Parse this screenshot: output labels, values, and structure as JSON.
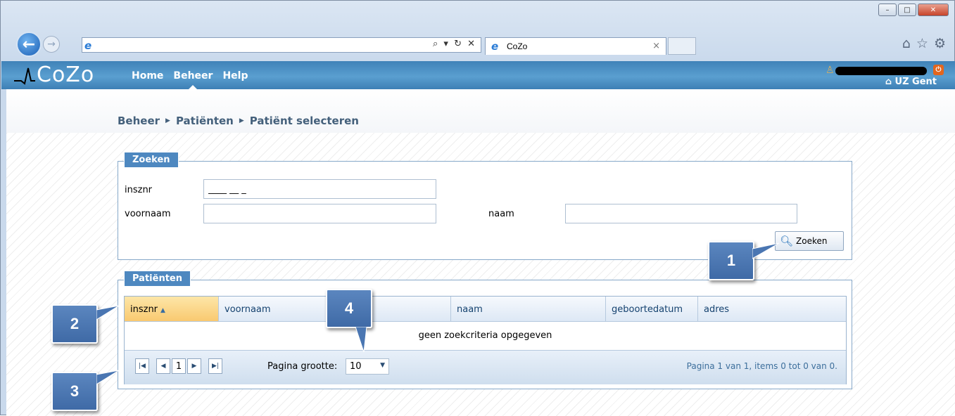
{
  "browser": {
    "tab_title": "CoZo",
    "tab_close": "×",
    "address_tools": "⌕ ▾ ↻ ✕",
    "window_controls": {
      "minimize": "–",
      "maximize": "□",
      "close": "✕"
    },
    "icons": [
      "home-icon",
      "star-icon",
      "gear-icon"
    ]
  },
  "app": {
    "logo_text": "CoZo",
    "nav": [
      "Home",
      "Beheer",
      "Help"
    ],
    "active_nav": "Beheer",
    "org_name": "UZ Gent",
    "user_name_redacted": true
  },
  "breadcrumb": [
    "Beheer",
    "Patiënten",
    "Patiënt selecteren"
  ],
  "search": {
    "legend": "Zoeken",
    "insznr_label": "insznr",
    "insznr_value": "____ __ _",
    "voornaam_label": "voornaam",
    "voornaam_value": "",
    "naam_label": "naam",
    "naam_value": "",
    "button_label": "Zoeken"
  },
  "results": {
    "legend": "Patiënten",
    "columns": [
      "insznr",
      "voornaam",
      "naam",
      "geboortedatum",
      "adres"
    ],
    "sorted_column": "insznr",
    "empty_message": "geen zoekcriteria opgegeven",
    "pager": {
      "current_page": "1",
      "page_size_label": "Pagina grootte:",
      "page_size": "10",
      "info": "Pagina 1 van 1, items 0 tot 0 van 0."
    }
  },
  "callouts": [
    "1",
    "2",
    "3",
    "4"
  ],
  "colors": {
    "header_blue": "#4f8fc4",
    "legend_blue": "#4e88c0",
    "sorted_header": "#f9c970",
    "callout_blue": "#4a76b2",
    "logout_orange": "#e3661e"
  }
}
